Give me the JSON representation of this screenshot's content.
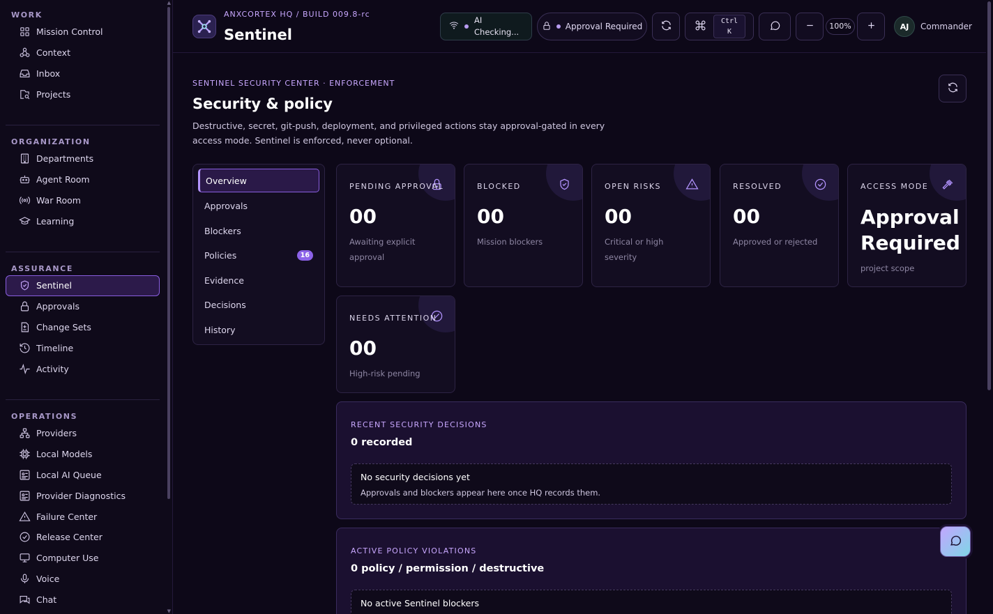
{
  "sidebar": {
    "sections": [
      {
        "heading": "WORK",
        "items": [
          {
            "label": "Mission Control",
            "icon": "grid-icon"
          },
          {
            "label": "Context",
            "icon": "hub-icon"
          },
          {
            "label": "Inbox",
            "icon": "inbox-icon"
          },
          {
            "label": "Projects",
            "icon": "project-search-icon"
          }
        ]
      },
      {
        "heading": "ORGANIZATION",
        "items": [
          {
            "label": "Departments",
            "icon": "building-icon"
          },
          {
            "label": "Agent Room",
            "icon": "bot-icon"
          },
          {
            "label": "War Room",
            "icon": "broadcast-icon"
          },
          {
            "label": "Learning",
            "icon": "graduation-cap-icon"
          }
        ]
      },
      {
        "heading": "ASSURANCE",
        "items": [
          {
            "label": "Sentinel",
            "icon": "shield-icon",
            "active": true
          },
          {
            "label": "Approvals",
            "icon": "lock-icon"
          },
          {
            "label": "Change Sets",
            "icon": "file-diff-icon"
          },
          {
            "label": "Timeline",
            "icon": "history-icon"
          },
          {
            "label": "Activity",
            "icon": "pulse-icon"
          }
        ]
      },
      {
        "heading": "OPERATIONS",
        "items": [
          {
            "label": "Providers",
            "icon": "network-icon"
          },
          {
            "label": "Local Models",
            "icon": "chip-icon"
          },
          {
            "label": "Local AI Queue",
            "icon": "queue-icon"
          },
          {
            "label": "Provider Diagnostics",
            "icon": "diagnostics-icon"
          },
          {
            "label": "Failure Center",
            "icon": "warning-icon"
          },
          {
            "label": "Release Center",
            "icon": "check-circle-icon"
          },
          {
            "label": "Computer Use",
            "icon": "monitor-icon"
          },
          {
            "label": "Voice",
            "icon": "mic-icon"
          },
          {
            "label": "Chat",
            "icon": "chat-icon"
          }
        ]
      }
    ]
  },
  "header": {
    "breadcrumb": "ANXCORTEX HQ / BUILD 009.8-rc",
    "title": "Sentinel",
    "ai_status_line1": "AI",
    "ai_status_line2": "Checking...",
    "approval_label": "Approval Required",
    "shortcut_line1": "Ctrl",
    "shortcut_line2": "K",
    "zoom": "100%",
    "avatar_initials": "AJ",
    "user_name": "Commander"
  },
  "page": {
    "eyebrow": "SENTINEL SECURITY CENTER · ENFORCEMENT",
    "title": "Security & policy",
    "description": "Destructive, secret, git-push, deployment, and privileged actions stay approval-gated in every access mode. Sentinel is enforced, never optional."
  },
  "subnav": [
    {
      "label": "Overview",
      "active": true
    },
    {
      "label": "Approvals"
    },
    {
      "label": "Blockers"
    },
    {
      "label": "Policies",
      "badge": "16"
    },
    {
      "label": "Evidence"
    },
    {
      "label": "Decisions"
    },
    {
      "label": "History"
    }
  ],
  "cards": [
    {
      "label": "PENDING APPROVAL",
      "value": "00",
      "sub": "Awaiting explicit approval",
      "icon": "lock-icon"
    },
    {
      "label": "BLOCKED",
      "value": "00",
      "sub": "Mission blockers",
      "icon": "shield-icon"
    },
    {
      "label": "OPEN RISKS",
      "value": "00",
      "sub": "Critical or high severity",
      "icon": "warning-icon"
    },
    {
      "label": "RESOLVED",
      "value": "00",
      "sub": "Approved or rejected",
      "icon": "check-circle-icon"
    },
    {
      "label": "ACCESS MODE",
      "value": "Approval Required",
      "sub": "project scope",
      "icon": "gavel-icon"
    },
    {
      "label": "NEEDS ATTENTION",
      "value": "00",
      "sub": "High-risk pending",
      "icon": "check-circle-icon"
    }
  ],
  "panels": [
    {
      "eyebrow": "RECENT SECURITY DECISIONS",
      "title": "0 recorded",
      "empty_title": "No security decisions yet",
      "empty_sub": "Approvals and blockers appear here once HQ records them."
    },
    {
      "eyebrow": "ACTIVE POLICY VIOLATIONS",
      "title": "0 policy / permission / destructive",
      "empty_title": "No active Sentinel blockers",
      "empty_sub": ""
    }
  ],
  "colors": {
    "accent": "#b394ff",
    "background": "#0d0818",
    "card": "#130d21",
    "panel": "#1b1030"
  }
}
